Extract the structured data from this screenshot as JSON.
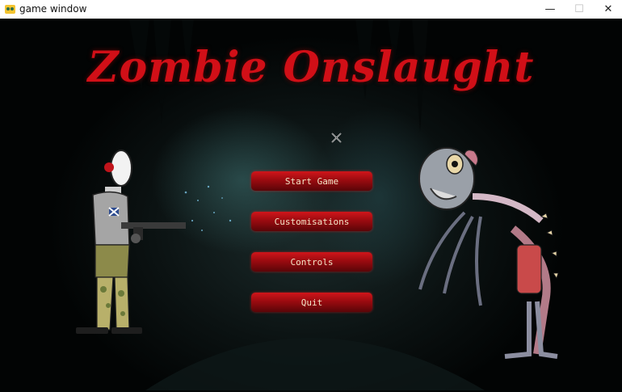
{
  "window": {
    "title": "game window",
    "controls": {
      "minimize": "—",
      "maximize": "☐",
      "close": "✕"
    }
  },
  "game": {
    "title": "Zombie Onslaught"
  },
  "menu": {
    "start": "Start Game",
    "customisations": "Customisations",
    "controls": "Controls",
    "quit": "Quit"
  },
  "colors": {
    "title_red": "#d10f17",
    "button_red": "#b3101a",
    "button_text": "#f3e6c8"
  }
}
